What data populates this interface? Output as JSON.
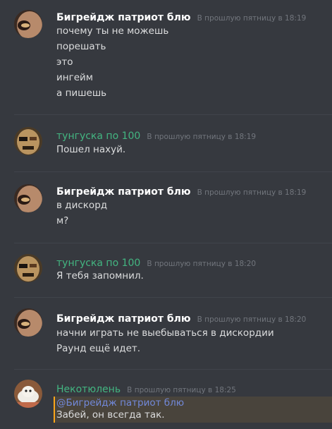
{
  "colors": {
    "background": "#36393f",
    "author_white": "#ffffff",
    "author_green": "#43b581",
    "timestamp": "#72767d",
    "mention": "#7289da",
    "mention_highlight": "#49443c",
    "mention_border": "#faa61a"
  },
  "messages": [
    {
      "author": "Бигрейдж патриот блю",
      "timestamp": "В прошлую пятницу в 18:19",
      "lines": [
        "почему ты не можешь",
        "порешать",
        "это",
        "ингейм",
        "а пишешь"
      ]
    },
    {
      "author": "тунгуска по 100",
      "timestamp": "В прошлую пятницу в 18:19",
      "lines": [
        "Пошел нахуй."
      ]
    },
    {
      "author": "Бигрейдж патриот блю",
      "timestamp": "В прошлую пятницу в 18:19",
      "lines": [
        "в дискорд",
        "м?"
      ]
    },
    {
      "author": "тунгуска по 100",
      "timestamp": "В прошлую пятницу в 18:20",
      "lines": [
        "Я тебя запомнил."
      ]
    },
    {
      "author": "Бигрейдж патриот блю",
      "timestamp": "В прошлую пятницу в 18:20",
      "lines": [
        "начни играть  не выебываться в дискордии",
        "Раунд ещё идет."
      ]
    },
    {
      "author": "Некотюлень",
      "timestamp": "В прошлую пятницу в 18:25",
      "mention": "@Бигрейдж патриот блю",
      "lines": [
        "Забей, он всегда так."
      ]
    }
  ]
}
